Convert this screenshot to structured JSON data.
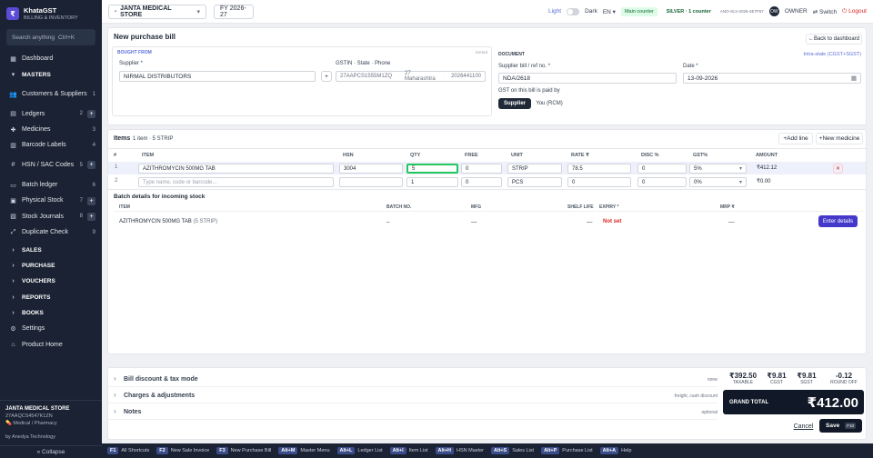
{
  "sidebar": {
    "logo_glyph": "₹",
    "brand": "KhataGST",
    "brand_sub": "BILLING & INVENTORY",
    "search_placeholder": "Search anything",
    "search_shortcut": "Ctrl+K",
    "items": [
      {
        "label": "Dashboard",
        "icon": "dashboard-icon",
        "glyph": "▦",
        "count": "",
        "plus": false,
        "section": false
      },
      {
        "label": "MASTERS",
        "icon": "chevron-down-icon",
        "glyph": "▾",
        "count": "",
        "plus": false,
        "section": true
      },
      {
        "label": "Customers & Suppliers",
        "icon": "users-icon",
        "glyph": "👥",
        "count": "1",
        "plus": false,
        "section": false,
        "tall": true
      },
      {
        "label": "Ledgers",
        "icon": "ledger-icon",
        "glyph": "▤",
        "count": "2",
        "plus": true,
        "section": false
      },
      {
        "label": "Medicines",
        "icon": "pill-icon",
        "glyph": "✚",
        "count": "3",
        "plus": false,
        "section": false
      },
      {
        "label": "Barcode Labels",
        "icon": "barcode-icon",
        "glyph": "▥",
        "count": "4",
        "plus": false,
        "section": false
      },
      {
        "label": "HSN / SAC Codes",
        "icon": "tag-icon",
        "glyph": "#",
        "count": "5",
        "plus": true,
        "section": false,
        "tall": true
      },
      {
        "label": "Batch ledger",
        "icon": "batch-icon",
        "glyph": "▭",
        "count": "6",
        "plus": false,
        "section": false
      },
      {
        "label": "Physical Stock",
        "icon": "box-icon",
        "glyph": "▣",
        "count": "7",
        "plus": true,
        "section": false
      },
      {
        "label": "Stock Journals",
        "icon": "journal-icon",
        "glyph": "▧",
        "count": "8",
        "plus": true,
        "section": false
      },
      {
        "label": "Duplicate Check",
        "icon": "check-icon",
        "glyph": "⤢",
        "count": "9",
        "plus": false,
        "section": false
      },
      {
        "label": "SALES",
        "icon": "chevron-right-icon",
        "glyph": "›",
        "count": "",
        "plus": false,
        "section": true
      },
      {
        "label": "PURCHASE",
        "icon": "chevron-right-icon",
        "glyph": "›",
        "count": "",
        "plus": false,
        "section": true
      },
      {
        "label": "VOUCHERS",
        "icon": "chevron-right-icon",
        "glyph": "›",
        "count": "",
        "plus": false,
        "section": true
      },
      {
        "label": "REPORTS",
        "icon": "chevron-right-icon",
        "glyph": "›",
        "count": "",
        "plus": false,
        "section": true
      },
      {
        "label": "BOOKS",
        "icon": "chevron-right-icon",
        "glyph": "›",
        "count": "",
        "plus": false,
        "section": true
      },
      {
        "label": "Settings",
        "icon": "gear-icon",
        "glyph": "⚙",
        "count": "",
        "plus": false,
        "section": false
      },
      {
        "label": "Product Home",
        "icon": "home-icon",
        "glyph": "⌂",
        "count": "",
        "plus": false,
        "section": false
      }
    ],
    "footer": {
      "firm": "JANTA MEDICAL STORE",
      "gstin": "27AAQCS4547K1ZN",
      "type": "💊 Medical / Pharmacy",
      "by": "by Anedya Technology",
      "collapse": "« Collapse"
    }
  },
  "topbar": {
    "firm": "JANTA MEDICAL STORE",
    "fy": "FY 2026-27",
    "light": "Light",
    "dark": "Dark",
    "lang": "EN",
    "counter": "Main counter",
    "plan": "SILVER · 1 counter",
    "key": "ANO-SLV-2026-4E7F67",
    "avatar": "OW",
    "owner": "OWNER",
    "switch": "Switch",
    "logout": "Logout"
  },
  "form": {
    "title": "New purchase bill",
    "back": "Back to dashboard",
    "bought_from": "BOUGHT FROM",
    "sorted": "Sorted",
    "supplier_label": "Supplier *",
    "supplier_value": "NIRMAL DISTRIBUTORS",
    "gstin_label": "GSTIN · State · Phone",
    "gstin": "27AAPCS1555M1ZQ",
    "state": "27 Maharashtra",
    "phone": "2026441100",
    "document": "DOCUMENT",
    "intra": "Intra-state (CGST+SGST)",
    "bill_label": "Supplier bill / ref no. *",
    "bill_value": "NDA/2618",
    "date_label": "Date *",
    "date_value": "13-09-2026",
    "gst_paid_label": "GST on this bill is paid by",
    "opt_supplier": "Supplier",
    "opt_rcm": "You (RCM)"
  },
  "items": {
    "title": "Items",
    "summary": "1 item · 5 STRIP",
    "add_line": "Add line",
    "new_medicine": "New medicine",
    "headers": [
      "#",
      "ITEM",
      "HSN",
      "QTY",
      "FREE",
      "UNIT",
      "RATE ₹",
      "DISC %",
      "GST%",
      "AMOUNT"
    ],
    "rows": [
      {
        "n": "1",
        "item": "AZITHROMYCIN 500MG TAB",
        "hsn": "3004",
        "qty": "5",
        "free": "0",
        "unit": "STRIP",
        "rate": "78.5",
        "disc": "0",
        "gst": "5%",
        "amount": "₹412.12"
      },
      {
        "n": "2",
        "item": "",
        "placeholder": "Type name, code or barcode...",
        "hsn": "",
        "qty": "1",
        "free": "0",
        "unit": "PCS",
        "rate": "0",
        "disc": "0",
        "gst": "0%",
        "amount": "₹0.00"
      }
    ],
    "batch_title": "Batch details for incoming stock",
    "batch_headers": [
      "ITEM",
      "BATCH NO.",
      "MFG",
      "SHELF LIFE",
      "EXPIRY *",
      "MRP ₹"
    ],
    "batch_row": {
      "item": "AZITHROMYCIN 500MG TAB",
      "qty": "(5 STRIP)",
      "batch": "–",
      "mfg": "—",
      "shelf": "—",
      "expiry": "Not set",
      "mrp": "—",
      "action": "Enter details"
    }
  },
  "summary": {
    "rows": [
      {
        "label": "Bill discount & tax mode",
        "hint": "none"
      },
      {
        "label": "Charges & adjustments",
        "hint": "freight, cash discount"
      },
      {
        "label": "Notes",
        "hint": "optional"
      }
    ],
    "taxable": "₹392.50",
    "taxable_l": "TAXABLE",
    "cgst": "₹9.81",
    "cgst_l": "CGST",
    "sgst": "₹9.81",
    "sgst_l": "SGST",
    "round": "-0.12",
    "round_l": "ROUND OFF",
    "grand_l": "GRAND TOTAL",
    "grand": "₹412.00",
    "cancel": "Cancel",
    "save": "Save",
    "save_key": "F10"
  },
  "shortcuts": [
    {
      "k": "F1",
      "t": "All Shortcuts"
    },
    {
      "k": "F2",
      "t": "New Sale Invoice"
    },
    {
      "k": "F3",
      "t": "New Purchase Bill"
    },
    {
      "k": "Alt+M",
      "t": "Master Menu"
    },
    {
      "k": "Alt+L",
      "t": "Ledger List"
    },
    {
      "k": "Alt+I",
      "t": "Item List"
    },
    {
      "k": "Alt+H",
      "t": "HSN Master"
    },
    {
      "k": "Alt+S",
      "t": "Sales List"
    },
    {
      "k": "Alt+P",
      "t": "Purchase List"
    },
    {
      "k": "Alt+A",
      "t": "Help"
    }
  ]
}
